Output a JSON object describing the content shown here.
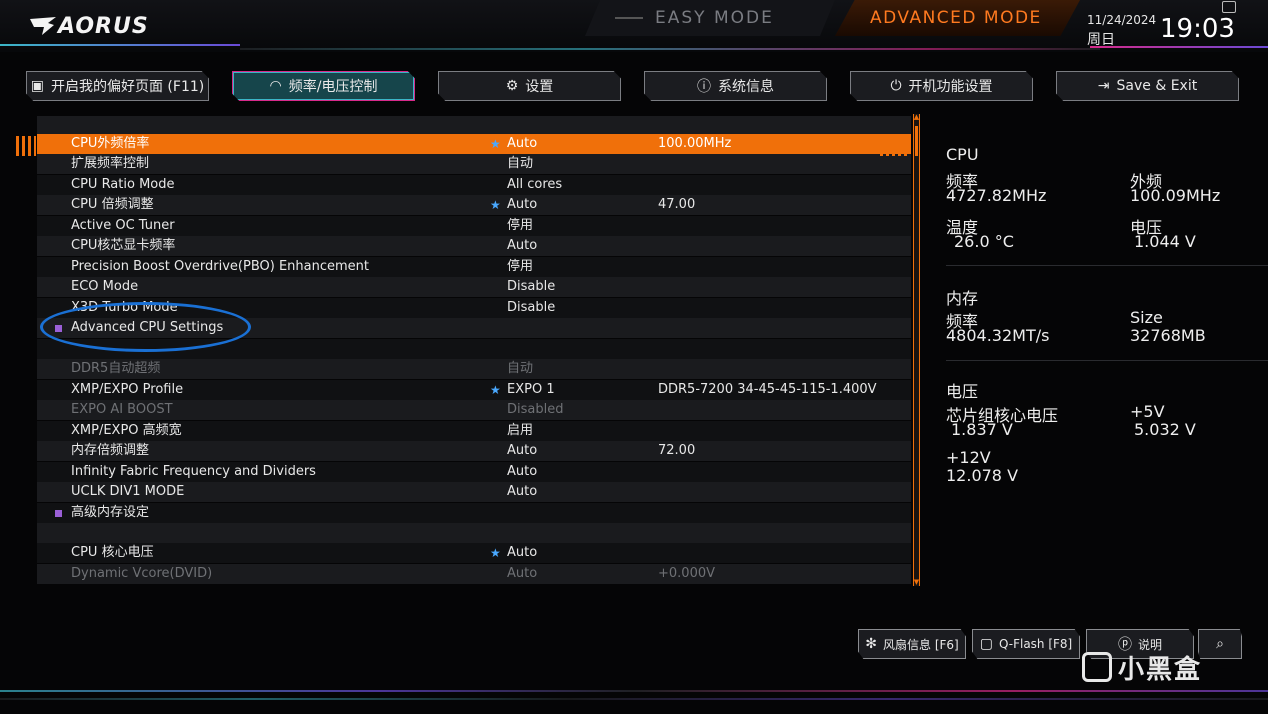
{
  "header": {
    "logo": "AORUS",
    "easy_mode": "EASY MODE",
    "advanced_mode": "ADVANCED MODE",
    "date": "11/24/2024",
    "weekday": "周日",
    "time": "19:03"
  },
  "tabs": [
    {
      "label": "开启我的偏好页面 (F11)",
      "icon": "favorites-icon"
    },
    {
      "label": "频率/电压控制",
      "icon": "speedometer-icon"
    },
    {
      "label": "设置",
      "icon": "gear-icon"
    },
    {
      "label": "系统信息",
      "icon": "info-icon"
    },
    {
      "label": "开机功能设置",
      "icon": "power-icon"
    },
    {
      "label": "Save & Exit",
      "icon": "exit-icon"
    }
  ],
  "settings": [
    {
      "label": "CPU外频倍率",
      "value": "Auto",
      "value2": "100.00MHz",
      "star": "★"
    },
    {
      "label": "扩展频率控制",
      "value": "自动",
      "value2": "",
      "star": ""
    },
    {
      "label": "CPU Ratio Mode",
      "value": "All cores",
      "value2": "",
      "star": ""
    },
    {
      "label": "CPU 倍频调整",
      "value": "Auto",
      "value2": "47.00",
      "star": "★"
    },
    {
      "label": "Active OC Tuner",
      "value": "停用",
      "value2": "",
      "star": ""
    },
    {
      "label": "CPU核芯显卡频率",
      "value": "Auto",
      "value2": "",
      "star": ""
    },
    {
      "label": "Precision Boost Overdrive(PBO) Enhancement",
      "value": "停用",
      "value2": "",
      "star": ""
    },
    {
      "label": "ECO Mode",
      "value": "Disable",
      "value2": "",
      "star": ""
    },
    {
      "label": "X3D Turbo Mode",
      "value": "Disable",
      "value2": "",
      "star": ""
    },
    {
      "label": "Advanced CPU Settings",
      "value": "",
      "value2": "",
      "star": ""
    },
    {
      "label": "",
      "value": "",
      "value2": "",
      "star": ""
    },
    {
      "label": "DDR5自动超频",
      "value": "自动",
      "value2": "",
      "star": ""
    },
    {
      "label": "XMP/EXPO Profile",
      "value": "EXPO 1",
      "value2": "DDR5-7200 34-45-45-115-1.400V",
      "star": "★"
    },
    {
      "label": "EXPO AI BOOST",
      "value": "Disabled",
      "value2": "",
      "star": ""
    },
    {
      "label": "XMP/EXPO 高频宽",
      "value": "启用",
      "value2": "",
      "star": ""
    },
    {
      "label": "内存倍频调整",
      "value": "Auto",
      "value2": "72.00",
      "star": ""
    },
    {
      "label": "Infinity Fabric Frequency and Dividers",
      "value": "Auto",
      "value2": "",
      "star": ""
    },
    {
      "label": "UCLK DIV1 MODE",
      "value": "Auto",
      "value2": "",
      "star": ""
    },
    {
      "label": "高级内存设定",
      "value": "",
      "value2": "",
      "star": ""
    },
    {
      "label": "",
      "value": "",
      "value2": "",
      "star": ""
    },
    {
      "label": "CPU 核心电压",
      "value": "Auto",
      "value2": "",
      "star": "★"
    },
    {
      "label": "Dynamic Vcore(DVID)",
      "value": "Auto",
      "value2": "+0.000V",
      "star": ""
    }
  ],
  "right_panel": {
    "cpu": {
      "title": "CPU",
      "freq_label": "频率",
      "freq": "4727.82MHz",
      "bclk_label": "外频",
      "bclk": "100.09MHz",
      "temp_label": "温度",
      "temp": "26.0 °C",
      "volt_label": "电压",
      "volt": "1.044 V"
    },
    "memory": {
      "title": "内存",
      "freq_label": "频率",
      "freq": "4804.32MT/s",
      "size_label": "Size",
      "size": "32768MB"
    },
    "voltage": {
      "title": "电压",
      "chipset_label": "芯片组核心电压",
      "chipset": "1.837 V",
      "v5_label": "+5V",
      "v5": "5.032 V",
      "v12_label": "+12V",
      "v12": "12.078 V"
    }
  },
  "bottom": {
    "fan": "风扇信息 [F6]",
    "qflash": "Q-Flash [F8]",
    "help": "说明",
    "watermark": "小黑盒"
  },
  "colors": {
    "accent": "#f0700a",
    "tab_active": "#16454b",
    "annotation": "#1a70d4",
    "star": "#4aa9ff"
  }
}
